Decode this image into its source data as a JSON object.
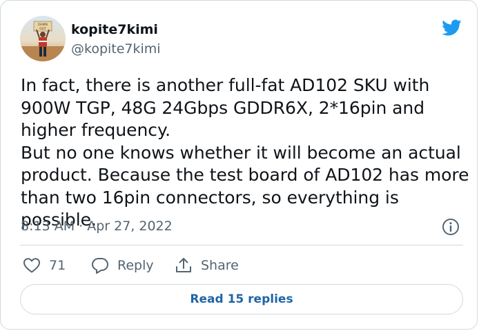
{
  "author": {
    "display_name": "kopite7kimi",
    "handle": "@kopite7kimi",
    "avatar_icon": "avatar-photo-person-holding-sign"
  },
  "avatar_sign_text": "DAMN OUT",
  "logo_icon": "twitter-bird-icon",
  "tweet": {
    "text": "In fact, there is another full-fat AD102 SKU with\n900W TGP, 48G 24Gbps GDDR6X, 2*16pin and\nhigher frequency.\nBut no one knows whether it will become an actual\nproduct. Because the test board of AD102 has more\nthan two 16pin connectors, so everything is possible.",
    "timestamp": "8:13 AM · Apr 27, 2022"
  },
  "actions": {
    "like_count": "71",
    "reply_label": "Reply",
    "share_label": "Share"
  },
  "read_replies_label": "Read 15 replies",
  "colors": {
    "text_primary": "#0f1419",
    "text_secondary": "#536471",
    "brand_blue": "#1d9bf0",
    "link_blue": "#1d65a6",
    "border": "#cfd9de"
  }
}
